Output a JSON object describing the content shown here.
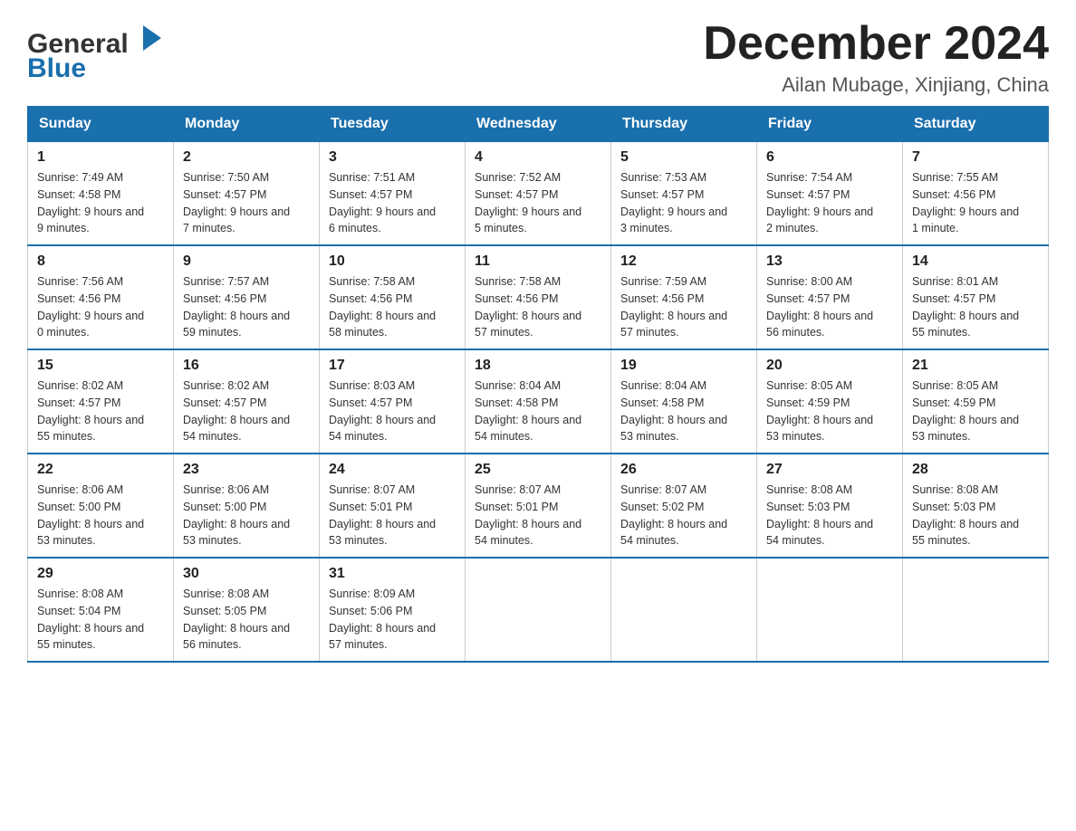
{
  "header": {
    "logo_general": "General",
    "logo_blue": "Blue",
    "month_title": "December 2024",
    "location": "Ailan Mubage, Xinjiang, China"
  },
  "days_of_week": [
    "Sunday",
    "Monday",
    "Tuesday",
    "Wednesday",
    "Thursday",
    "Friday",
    "Saturday"
  ],
  "weeks": [
    [
      {
        "day": "1",
        "sunrise": "7:49 AM",
        "sunset": "4:58 PM",
        "daylight": "9 hours and 9 minutes."
      },
      {
        "day": "2",
        "sunrise": "7:50 AM",
        "sunset": "4:57 PM",
        "daylight": "9 hours and 7 minutes."
      },
      {
        "day": "3",
        "sunrise": "7:51 AM",
        "sunset": "4:57 PM",
        "daylight": "9 hours and 6 minutes."
      },
      {
        "day": "4",
        "sunrise": "7:52 AM",
        "sunset": "4:57 PM",
        "daylight": "9 hours and 5 minutes."
      },
      {
        "day": "5",
        "sunrise": "7:53 AM",
        "sunset": "4:57 PM",
        "daylight": "9 hours and 3 minutes."
      },
      {
        "day": "6",
        "sunrise": "7:54 AM",
        "sunset": "4:57 PM",
        "daylight": "9 hours and 2 minutes."
      },
      {
        "day": "7",
        "sunrise": "7:55 AM",
        "sunset": "4:56 PM",
        "daylight": "9 hours and 1 minute."
      }
    ],
    [
      {
        "day": "8",
        "sunrise": "7:56 AM",
        "sunset": "4:56 PM",
        "daylight": "9 hours and 0 minutes."
      },
      {
        "day": "9",
        "sunrise": "7:57 AM",
        "sunset": "4:56 PM",
        "daylight": "8 hours and 59 minutes."
      },
      {
        "day": "10",
        "sunrise": "7:58 AM",
        "sunset": "4:56 PM",
        "daylight": "8 hours and 58 minutes."
      },
      {
        "day": "11",
        "sunrise": "7:58 AM",
        "sunset": "4:56 PM",
        "daylight": "8 hours and 57 minutes."
      },
      {
        "day": "12",
        "sunrise": "7:59 AM",
        "sunset": "4:56 PM",
        "daylight": "8 hours and 57 minutes."
      },
      {
        "day": "13",
        "sunrise": "8:00 AM",
        "sunset": "4:57 PM",
        "daylight": "8 hours and 56 minutes."
      },
      {
        "day": "14",
        "sunrise": "8:01 AM",
        "sunset": "4:57 PM",
        "daylight": "8 hours and 55 minutes."
      }
    ],
    [
      {
        "day": "15",
        "sunrise": "8:02 AM",
        "sunset": "4:57 PM",
        "daylight": "8 hours and 55 minutes."
      },
      {
        "day": "16",
        "sunrise": "8:02 AM",
        "sunset": "4:57 PM",
        "daylight": "8 hours and 54 minutes."
      },
      {
        "day": "17",
        "sunrise": "8:03 AM",
        "sunset": "4:57 PM",
        "daylight": "8 hours and 54 minutes."
      },
      {
        "day": "18",
        "sunrise": "8:04 AM",
        "sunset": "4:58 PM",
        "daylight": "8 hours and 54 minutes."
      },
      {
        "day": "19",
        "sunrise": "8:04 AM",
        "sunset": "4:58 PM",
        "daylight": "8 hours and 53 minutes."
      },
      {
        "day": "20",
        "sunrise": "8:05 AM",
        "sunset": "4:59 PM",
        "daylight": "8 hours and 53 minutes."
      },
      {
        "day": "21",
        "sunrise": "8:05 AM",
        "sunset": "4:59 PM",
        "daylight": "8 hours and 53 minutes."
      }
    ],
    [
      {
        "day": "22",
        "sunrise": "8:06 AM",
        "sunset": "5:00 PM",
        "daylight": "8 hours and 53 minutes."
      },
      {
        "day": "23",
        "sunrise": "8:06 AM",
        "sunset": "5:00 PM",
        "daylight": "8 hours and 53 minutes."
      },
      {
        "day": "24",
        "sunrise": "8:07 AM",
        "sunset": "5:01 PM",
        "daylight": "8 hours and 53 minutes."
      },
      {
        "day": "25",
        "sunrise": "8:07 AM",
        "sunset": "5:01 PM",
        "daylight": "8 hours and 54 minutes."
      },
      {
        "day": "26",
        "sunrise": "8:07 AM",
        "sunset": "5:02 PM",
        "daylight": "8 hours and 54 minutes."
      },
      {
        "day": "27",
        "sunrise": "8:08 AM",
        "sunset": "5:03 PM",
        "daylight": "8 hours and 54 minutes."
      },
      {
        "day": "28",
        "sunrise": "8:08 AM",
        "sunset": "5:03 PM",
        "daylight": "8 hours and 55 minutes."
      }
    ],
    [
      {
        "day": "29",
        "sunrise": "8:08 AM",
        "sunset": "5:04 PM",
        "daylight": "8 hours and 55 minutes."
      },
      {
        "day": "30",
        "sunrise": "8:08 AM",
        "sunset": "5:05 PM",
        "daylight": "8 hours and 56 minutes."
      },
      {
        "day": "31",
        "sunrise": "8:09 AM",
        "sunset": "5:06 PM",
        "daylight": "8 hours and 57 minutes."
      },
      null,
      null,
      null,
      null
    ]
  ],
  "labels": {
    "sunrise": "Sunrise:",
    "sunset": "Sunset:",
    "daylight": "Daylight:"
  }
}
